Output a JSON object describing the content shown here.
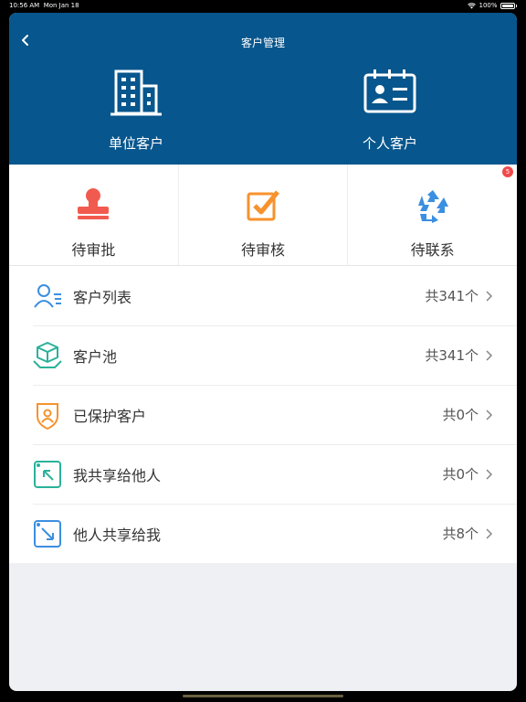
{
  "status_bar": {
    "time": "10:56 AM",
    "date": "Mon Jan 18",
    "battery": "100%"
  },
  "header": {
    "title": "客户管理"
  },
  "customer_types": [
    {
      "label": "单位客户",
      "icon": "building-icon"
    },
    {
      "label": "个人客户",
      "icon": "id-card-icon"
    }
  ],
  "status_items": [
    {
      "label": "待审批",
      "icon": "stamp-icon",
      "color": "#f15b4f"
    },
    {
      "label": "待审核",
      "icon": "checkbox-icon",
      "color": "#f7922d"
    },
    {
      "label": "待联系",
      "icon": "recycle-icon",
      "color": "#3b8fe0",
      "badge": "5"
    }
  ],
  "list_items": [
    {
      "label": "客户列表",
      "count": "共341个",
      "icon": "user-list-icon",
      "color": "#3b8fe0"
    },
    {
      "label": "客户池",
      "count": "共341个",
      "icon": "box-hand-icon",
      "color": "#2ab29a"
    },
    {
      "label": "已保护客户",
      "count": "共0个",
      "icon": "shield-user-icon",
      "color": "#f7922d"
    },
    {
      "label": "我共享给他人",
      "count": "共0个",
      "icon": "share-out-icon",
      "color": "#2ab29a"
    },
    {
      "label": "他人共享给我",
      "count": "共8个",
      "icon": "share-in-icon",
      "color": "#3b8fe0"
    }
  ]
}
